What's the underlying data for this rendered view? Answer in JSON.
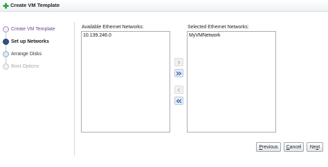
{
  "window": {
    "title": "Create VM Template",
    "icon": "green-plus-icon"
  },
  "steps": [
    {
      "label": "Create VM Template",
      "state": "completed"
    },
    {
      "label": "Set up Networks",
      "state": "current"
    },
    {
      "label": "Arrange Disks",
      "state": "upcoming"
    },
    {
      "label": "Boot Options",
      "state": "disabled"
    }
  ],
  "available": {
    "label": "Available Ethernet Networks:",
    "items": [
      "10.139.246.0"
    ]
  },
  "selected": {
    "label": "Selected Ethernet Networks:",
    "items": [
      "MyVMNetwork"
    ]
  },
  "shuttle": [
    {
      "action": "move-selected-right",
      "icon": "chevron-right-icon",
      "enabled": false
    },
    {
      "action": "move-all-right",
      "icon": "double-chevron-right-icon",
      "enabled": true
    },
    {
      "action": "move-selected-left",
      "icon": "chevron-left-icon",
      "enabled": false
    },
    {
      "action": "move-all-left",
      "icon": "double-chevron-left-icon",
      "enabled": true
    }
  ],
  "buttons": {
    "previous": {
      "mnemonic": "P",
      "rest": "revious"
    },
    "cancel": {
      "mnemonic": "C",
      "rest": "ancel"
    },
    "next": {
      "pre": "Ne",
      "mnemonic": "x",
      "post": "t"
    }
  },
  "colors": {
    "accent": "#30557e",
    "title_icon": "#3aa64a",
    "shuttle_arrow": "#3f6fa8",
    "visited_step": "#6a4a8a"
  }
}
